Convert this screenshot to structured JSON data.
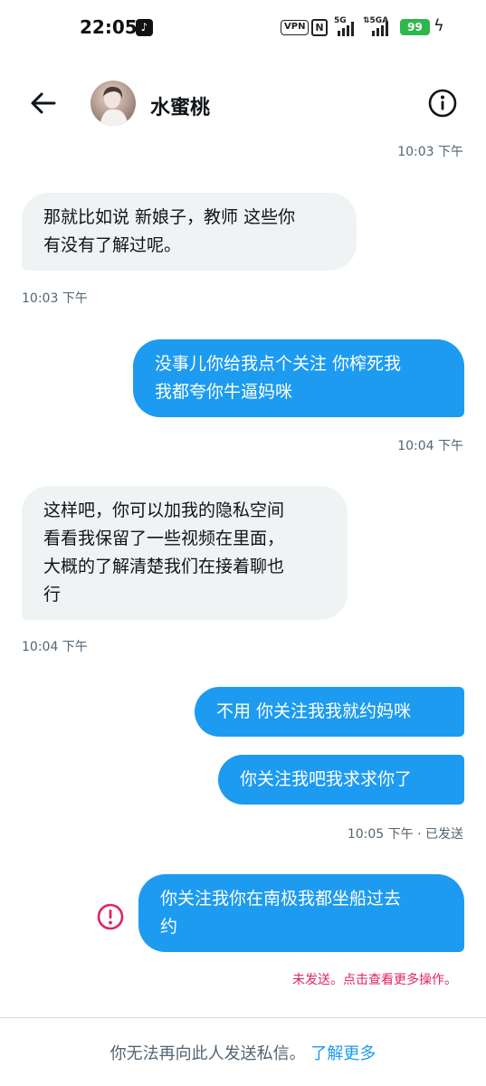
{
  "status_bar": {
    "time": "22:05",
    "app_icon": "tiktok-icon",
    "vpn": "VPN",
    "nfc": "N",
    "signal1_label": "5G",
    "signal2_label": "⇅5GA",
    "battery": "99"
  },
  "header": {
    "name": "水蜜桃",
    "back_icon": "back-arrow-icon",
    "info_icon": "info-icon"
  },
  "messages": [
    {
      "type": "timestamp",
      "side": "right",
      "text": "10:03 下午"
    },
    {
      "type": "incoming",
      "lines": [
        "那就比如说 新娘子，教师 这些你",
        "有没有了解过呢。"
      ]
    },
    {
      "type": "timestamp",
      "side": "left",
      "text": "10:03 下午"
    },
    {
      "type": "outgoing",
      "lines": [
        "没事儿你给我点个关注 你榨死我",
        "我都夸你牛逼妈咪"
      ]
    },
    {
      "type": "timestamp",
      "side": "right",
      "text": "10:04 下午"
    },
    {
      "type": "incoming",
      "lines": [
        "这样吧，你可以加我的隐私空间",
        "看看我保留了一些视频在里面，",
        "大概的了解清楚我们在接着聊也",
        "行"
      ]
    },
    {
      "type": "timestamp",
      "side": "left",
      "text": "10:04 下午"
    },
    {
      "type": "outgoing",
      "lines": [
        "不用 你关注我我就约妈咪"
      ]
    },
    {
      "type": "outgoing",
      "lines": [
        "你关注我吧我求求你了"
      ]
    },
    {
      "type": "timestamp",
      "side": "right",
      "text": "10:05 下午 · 已发送"
    },
    {
      "type": "outgoing",
      "status": "failed",
      "lines": [
        "你关注我你在南极我都坐船过去",
        "约"
      ]
    }
  ],
  "error": {
    "icon": "error-icon",
    "text": "未发送。点击查看更多操作。"
  },
  "footer": {
    "notice": "你无法再向此人发送私信。",
    "link": "了解更多"
  },
  "colors": {
    "outgoing_bubble": "#1d9bf0",
    "incoming_bubble": "#eff3f4",
    "error": "#e0245e",
    "battery": "#2db84c"
  }
}
